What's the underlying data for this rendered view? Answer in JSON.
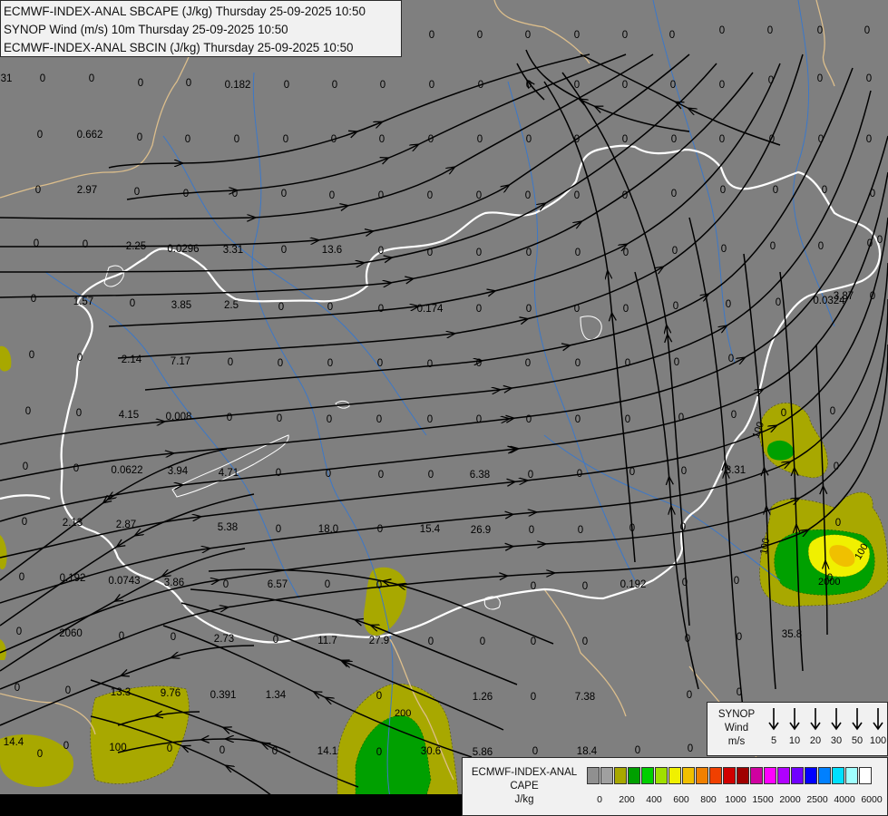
{
  "titles": {
    "line1": "ECMWF-INDEX-ANAL SBCAPE (J/kg) Thursday 25-09-2025 10:50",
    "line2": "SYNOP Wind (m/s) 10m Thursday 25-09-2025 10:50",
    "line3": "ECMWF-INDEX-ANAL SBCIN (J/kg) Thursday 25-09-2025 10:50"
  },
  "wind_legend": {
    "title_line1": "SYNOP",
    "title_line2": "Wind",
    "title_line3": "m/s",
    "speeds": [
      "5",
      "10",
      "20",
      "30",
      "50",
      "100"
    ]
  },
  "cape_legend": {
    "title_line1": "ECMWF-INDEX-ANAL",
    "title_line2": "CAPE",
    "title_line3": "J/kg",
    "colors": [
      "#909090",
      "#a0a0a0",
      "#a8a800",
      "#00a000",
      "#00d000",
      "#a0e000",
      "#f0f000",
      "#f0c000",
      "#f08000",
      "#f04000",
      "#d00000",
      "#a00000",
      "#d000a0",
      "#ff00ff",
      "#b000ff",
      "#7000ff",
      "#0000ff",
      "#0080ff",
      "#00e0ff",
      "#a0ffff",
      "#ffffff"
    ],
    "ticks": [
      "0",
      "200",
      "400",
      "600",
      "800",
      "1000",
      "1500",
      "2000",
      "2500",
      "4000",
      "6000"
    ]
  },
  "colors": {
    "background": "#7f7f7f",
    "cape_low": "#a8a800",
    "cape_mid": "#00a000",
    "cape_high": "#f0f000",
    "cape_peak": "#f0c000",
    "border_country": "#ffffff",
    "border_region": "#dcbe8c",
    "river": "#3c78c8",
    "streamline": "#000000",
    "label_text": "#000000"
  },
  "map_labels": [
    "0",
    "0",
    "0",
    "0",
    "0",
    "0",
    "0",
    "0",
    "0",
    "0",
    "0",
    "0",
    "31",
    "0",
    "0",
    "0",
    "0",
    "0.182",
    "0",
    "0",
    "0",
    "0",
    "0",
    "0",
    "0",
    "0",
    "0",
    "0",
    "0",
    "0",
    "0",
    "0",
    "0.662",
    "0",
    "0",
    "0",
    "0",
    "0",
    "0",
    "0",
    "0",
    "0",
    "0",
    "0",
    "0",
    "0",
    "0",
    "0",
    "0",
    "0",
    "2.97",
    "0",
    "0",
    "0",
    "0",
    "0",
    "0",
    "0",
    "0",
    "0",
    "0",
    "0",
    "0",
    "0",
    "0",
    "0",
    "0",
    "0",
    "0",
    "2.25",
    "0.0296",
    "3.31",
    "0",
    "13.6",
    "0",
    "0",
    "0",
    "0",
    "0",
    "0",
    "0",
    "0",
    "0",
    "0",
    "0",
    "0",
    "0",
    "1.57",
    "0",
    "3.85",
    "2.5",
    "0",
    "0",
    "0",
    "0.174",
    "0",
    "0",
    "0",
    "0",
    "0",
    "0",
    "0",
    "0.0324",
    "0",
    "3.87",
    "0",
    "0",
    "2.14",
    "7.17",
    "0",
    "0",
    "0",
    "0",
    "0",
    "0",
    "0",
    "0",
    "0",
    "0",
    "0",
    "0",
    "0",
    "4.15",
    "0.008",
    "0",
    "0",
    "0",
    "0",
    "0",
    "0",
    "0",
    "0",
    "0",
    "0",
    "0",
    "0",
    "0",
    "0",
    "0",
    "0.0622",
    "3.94",
    "4.71",
    "0",
    "0",
    "0",
    "0",
    "6.38",
    "0",
    "0",
    "0",
    "0",
    "8.31",
    "0",
    "0",
    "2.13",
    "2.87",
    "5.38",
    "0",
    "18.0",
    "0",
    "15.4",
    "26.9",
    "0",
    "0",
    "0",
    "0",
    "0",
    "0",
    "0.192",
    "0.0743",
    "3.86",
    "0",
    "6.57",
    "0",
    "0",
    "0",
    "0",
    "0.192",
    "0",
    "0",
    "0",
    "0",
    "2060",
    "0",
    "0",
    "2.73",
    "0",
    "11.7",
    "27.9",
    "0",
    "0",
    "0",
    "0",
    "0",
    "0",
    "35.8",
    "0",
    "0",
    "13.3",
    "9.76",
    "0.391",
    "1.34",
    "0",
    "1.26",
    "0",
    "7.38",
    "0",
    "0",
    "14.4",
    "0",
    "0",
    "100",
    "0",
    "0",
    "0",
    "14.1",
    "0",
    "30.6",
    "5.86",
    "0",
    "18.4",
    "0",
    "0",
    "0",
    "0"
  ],
  "contour_labels": [
    "100",
    "100",
    "100",
    "2000",
    "200"
  ]
}
